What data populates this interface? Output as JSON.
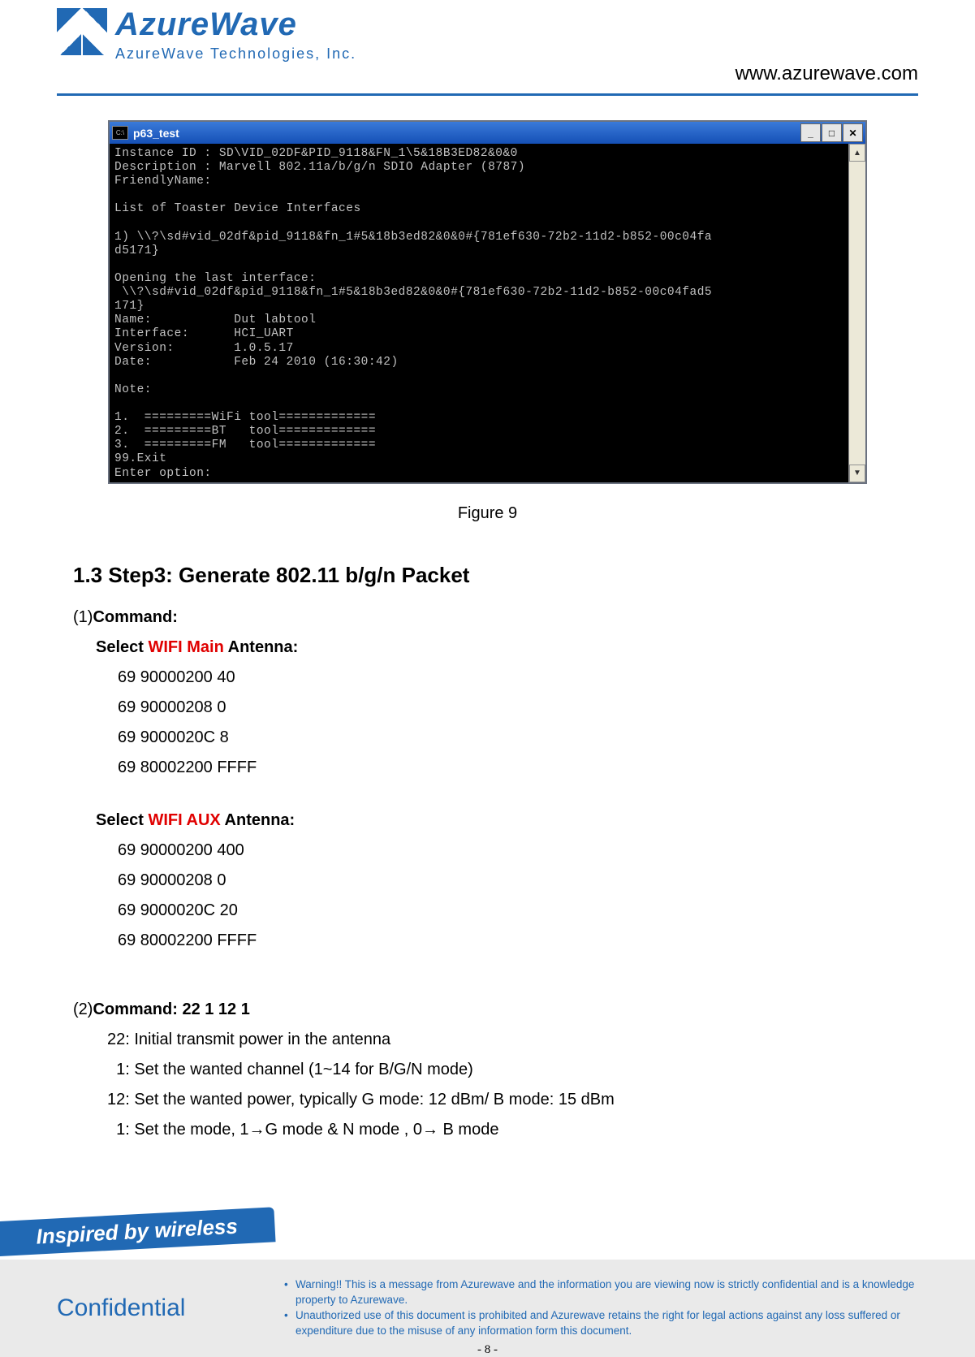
{
  "header": {
    "logo_title": "AzureWave",
    "logo_sub": "AzureWave  Technologies,  Inc.",
    "url": "www.azurewave.com"
  },
  "console": {
    "title_icon_text": "C:\\",
    "title": "p63_test",
    "body": "Instance ID : SD\\VID_02DF&PID_9118&FN_1\\5&18B3ED82&0&0\nDescription : Marvell 802.11a/b/g/n SDIO Adapter (8787)\nFriendlyName:\n\nList of Toaster Device Interfaces\n\n1) \\\\?\\sd#vid_02df&pid_9118&fn_1#5&18b3ed82&0&0#{781ef630-72b2-11d2-b852-00c04fa\nd5171}\n\nOpening the last interface:\n \\\\?\\sd#vid_02df&pid_9118&fn_1#5&18b3ed82&0&0#{781ef630-72b2-11d2-b852-00c04fad5\n171}\nName:           Dut labtool\nInterface:      HCI_UART\nVersion:        1.0.5.17\nDate:           Feb 24 2010 (16:30:42)\n\nNote:\n\n1.  =========WiFi tool=============\n2.  =========BT   tool=============\n3.  =========FM   tool=============\n99.Exit\nEnter option:"
  },
  "figure_caption": "Figure 9",
  "section": {
    "heading": "1.3 Step3: Generate 802.11 b/g/n Packet",
    "cmd1_prefix": "(1)",
    "cmd1_label": "Command:",
    "select_main_pre": "Select ",
    "select_main_red": "WIFI Main",
    "select_main_post": " Antenna:",
    "main_lines": [
      "69 90000200 40",
      "69 90000208 0",
      "69 9000020C 8",
      "69 80002200 FFFF"
    ],
    "select_aux_pre": "Select ",
    "select_aux_red": "WIFI AUX",
    "select_aux_post": " Antenna:",
    "aux_lines": [
      "69 90000200 400",
      "69 90000208 0",
      "69 9000020C 20",
      "69 80002200 FFFF"
    ],
    "cmd2_prefix": "(2)",
    "cmd2_label": "Command: 22 1 12 1",
    "desc_lines": [
      "22: Initial transmit power in the antenna",
      "  1: Set the wanted channel (1~14 for B/G/N mode)",
      "12: Set the wanted power, typically G mode: 12 dBm/ B mode: 15 dBm",
      "  1: Set the mode, 1→G mode & N mode , 0→ B mode"
    ]
  },
  "footer": {
    "tagline": "Inspired by wireless",
    "confidential": "Confidential",
    "warn1": "Warning!! This is a message from Azurewave and the information you are viewing now is strictly confidential and is a knowledge property to Azurewave.",
    "warn2": "Unauthorized use of this document is prohibited and Azurewave retains the right for legal actions against any loss suffered or expenditure due to the misuse of any information form this document.",
    "page_num": "- 8 -"
  }
}
